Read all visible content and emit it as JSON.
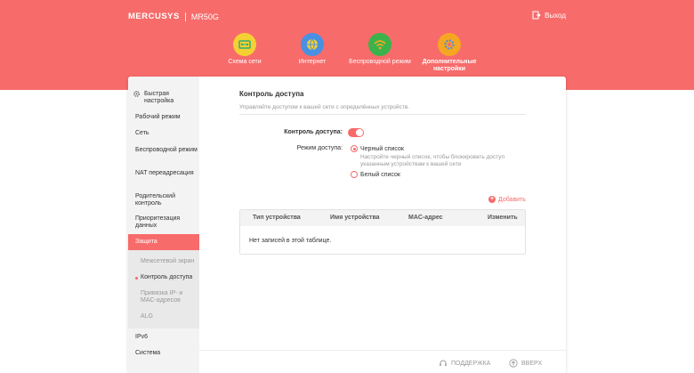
{
  "header": {
    "brand": "MERCUSYS",
    "model": "MR50G",
    "logout_label": "Выход",
    "accent_color": "#f76b6b"
  },
  "nav": [
    {
      "label": "Схема сети",
      "icon": "network-map-icon",
      "color": "#f5d033"
    },
    {
      "label": "Интернет",
      "icon": "globe-icon",
      "color": "#4a90e2"
    },
    {
      "label": "Беспроводной режим",
      "icon": "wifi-icon",
      "color": "#3cb34a"
    },
    {
      "label": "Дополнительные настройки",
      "icon": "gear-icon",
      "color": "#f5a623"
    }
  ],
  "sidebar": {
    "items": [
      {
        "label": "Быстрая настройка"
      },
      {
        "label": "Рабочий режим"
      },
      {
        "label": "Сеть"
      },
      {
        "label": "Беспроводной режим"
      },
      {
        "label": "NAT переадресация"
      },
      {
        "label": "Родительский контроль"
      },
      {
        "label": "Приоритезация данных"
      },
      {
        "label": "Защита"
      },
      {
        "label": "IPv6"
      },
      {
        "label": "Система"
      }
    ],
    "subitems": [
      {
        "label": "Межсетевой экран"
      },
      {
        "label": "Контроль доступа"
      },
      {
        "label": "Привязка IP- и MAC-адресов"
      },
      {
        "label": "ALG"
      }
    ]
  },
  "main": {
    "title": "Контроль доступа",
    "description": "Управляйте доступом к вашей сети с определённых устройств.",
    "access_control_label": "Контроль доступа:",
    "access_control_on": true,
    "mode_label": "Режим доступа:",
    "blacklist_label": "Черный список",
    "blacklist_hint": "Настройте черный список, чтобы блокировать доступ указанным устройствам к вашей сети",
    "whitelist_label": "Белый список",
    "add_label": "Добавить",
    "table": {
      "columns": [
        "Тип устройства",
        "Имя устройства",
        "MAC-адрес",
        "Изменить"
      ],
      "empty_text": "Нет записей в этой таблице."
    }
  },
  "footer": {
    "support_label": "ПОДДЕРЖКА",
    "top_label": "ВВЕРХ"
  }
}
